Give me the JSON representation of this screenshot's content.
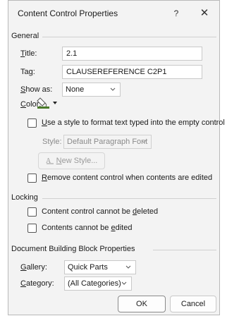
{
  "dialog": {
    "title": "Content Control Properties",
    "help": "?",
    "close": "✕"
  },
  "general": {
    "heading": "General",
    "title_label_u": "T",
    "title_label_rest": "itle:",
    "title_value": "2.1",
    "tag_label_pre": "Ta",
    "tag_label_u": "g",
    "tag_label_rest": ":",
    "tag_value": "CLAUSEREFERENCE C2P1",
    "showas_label_u": "S",
    "showas_label_rest": "how as:",
    "showas_value": "None",
    "color_label_u": "C",
    "color_label_rest": "olor:",
    "use_style_u": "U",
    "use_style_rest": "se a style to format text typed into the empty control",
    "style_label": "Style:",
    "style_value": "Default Paragraph Font",
    "new_style_u": "N",
    "new_style_rest": "ew Style...",
    "remove_pre": "",
    "remove_u": "R",
    "remove_rest": "emove content control when contents are edited"
  },
  "locking": {
    "heading": "Locking",
    "cannot_delete_pre": "Content control cannot be ",
    "cannot_delete_u": "d",
    "cannot_delete_rest": "eleted",
    "cannot_edit_pre": "Contents cannot be ",
    "cannot_edit_u": "e",
    "cannot_edit_rest": "dited"
  },
  "building_block": {
    "heading": "Document Building Block Properties",
    "gallery_label_u": "G",
    "gallery_label_rest": "allery:",
    "gallery_value": "Quick Parts",
    "category_label_u": "C",
    "category_label_rest": "ategory:",
    "category_value": "(All Categories)"
  },
  "buttons": {
    "ok": "OK",
    "cancel": "Cancel"
  },
  "colors": {
    "accent_paint": "#4a7a2a"
  }
}
